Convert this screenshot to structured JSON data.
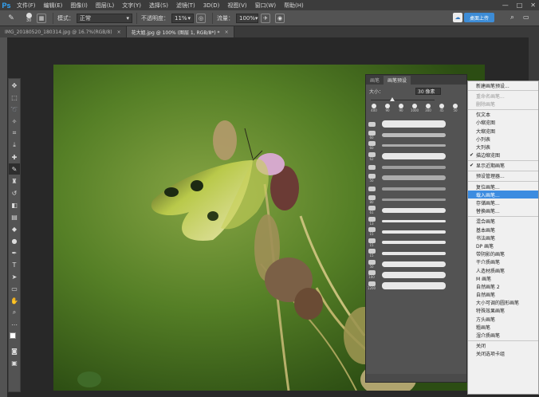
{
  "app": {
    "logo": "Ps"
  },
  "menu": [
    "文件(F)",
    "编辑(E)",
    "图像(I)",
    "图层(L)",
    "文字(Y)",
    "选择(S)",
    "滤镜(T)",
    "3D(D)",
    "视图(V)",
    "窗口(W)",
    "帮助(H)"
  ],
  "window_controls": {
    "minimize": "—",
    "maximize": "□",
    "close": "✕"
  },
  "options": {
    "brush_size": "30",
    "mode_label": "模式：",
    "mode_value": "正常",
    "opacity_label": "不透明度：",
    "opacity_value": "11%",
    "flow_label": "流量：",
    "flow_value": "100%",
    "share_label": "桌面上传"
  },
  "tabs": [
    {
      "label": "IMG_20180520_180314.jpg @ 16.7%(RGB/8)",
      "close": "×"
    },
    {
      "label": "花大姐.jpg @ 100% (图层 1, RGB/8*) *",
      "close": "×"
    }
  ],
  "brush_panel": {
    "tabs": [
      "画笔",
      "画笔预设"
    ],
    "size_label": "大小：",
    "size_value": "30 像素",
    "presets": [
      "400",
      "90",
      "90",
      "1000",
      "300",
      "45",
      "50"
    ],
    "rows": [
      {
        "num": ""
      },
      {
        "num": "60"
      },
      {
        "num": "60"
      },
      {
        "num": "62"
      },
      {
        "num": ""
      },
      {
        "num": "50"
      },
      {
        "num": ""
      },
      {
        "num": "80"
      },
      {
        "num": "61"
      },
      {
        "num": "13"
      },
      {
        "num": "15"
      },
      {
        "num": "15"
      },
      {
        "num": "15"
      },
      {
        "num": "50"
      },
      {
        "num": "100"
      },
      {
        "num": "1200"
      }
    ]
  },
  "context_menu": [
    {
      "label": "新建画笔预设...",
      "state": "normal"
    },
    {
      "sep": true
    },
    {
      "label": "重命名画笔...",
      "state": "disabled"
    },
    {
      "label": "删除画笔",
      "state": "disabled"
    },
    {
      "sep": true
    },
    {
      "label": "仅文本",
      "state": "normal"
    },
    {
      "label": "小缩览图",
      "state": "normal"
    },
    {
      "label": "大缩览图",
      "state": "normal"
    },
    {
      "label": "小列表",
      "state": "normal"
    },
    {
      "label": "大列表",
      "state": "normal"
    },
    {
      "label": "描边缩览图",
      "state": "checked"
    },
    {
      "sep": true
    },
    {
      "label": "显示近期画笔",
      "state": "checked"
    },
    {
      "sep": true
    },
    {
      "label": "预设管理器...",
      "state": "normal"
    },
    {
      "sep": true
    },
    {
      "label": "复位画笔...",
      "state": "normal"
    },
    {
      "label": "载入画笔...",
      "state": "highlight"
    },
    {
      "label": "存储画笔...",
      "state": "normal"
    },
    {
      "label": "替换画笔...",
      "state": "normal"
    },
    {
      "sep": true
    },
    {
      "label": "混合画笔",
      "state": "normal"
    },
    {
      "label": "基本画笔",
      "state": "normal"
    },
    {
      "label": "书法画笔",
      "state": "normal"
    },
    {
      "label": "DP 画笔",
      "state": "normal"
    },
    {
      "label": "带阴影的画笔",
      "state": "normal"
    },
    {
      "label": "干介质画笔",
      "state": "normal"
    },
    {
      "label": "人造材质画笔",
      "state": "normal"
    },
    {
      "label": "M 画笔",
      "state": "normal"
    },
    {
      "label": "自然画笔 2",
      "state": "normal"
    },
    {
      "label": "自然画笔",
      "state": "normal"
    },
    {
      "label": "大小可调的圆形画笔",
      "state": "normal"
    },
    {
      "label": "特殊效果画笔",
      "state": "normal"
    },
    {
      "label": "方头画笔",
      "state": "normal"
    },
    {
      "label": "粗画笔",
      "state": "normal"
    },
    {
      "label": "湿介质画笔",
      "state": "normal"
    },
    {
      "sep": true
    },
    {
      "label": "关闭",
      "state": "normal"
    },
    {
      "label": "关闭选项卡组",
      "state": "normal"
    }
  ]
}
